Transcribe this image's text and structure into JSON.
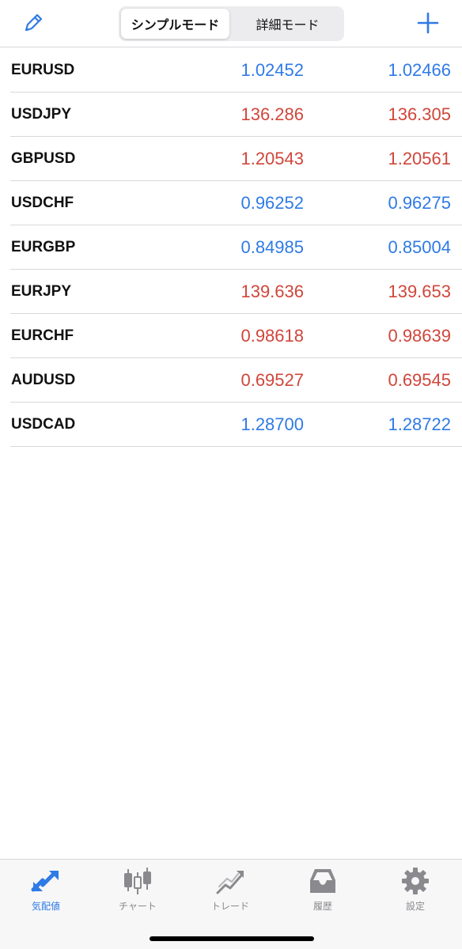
{
  "header": {
    "edit_icon": "pencil-icon",
    "add_icon": "plus-icon",
    "segments": [
      "シンプルモード",
      "詳細モード"
    ],
    "active_segment": "シンプルモード"
  },
  "colors": {
    "up": "#2f7ae5",
    "down": "#d0463b",
    "accent": "#2f7ae5"
  },
  "quotes": [
    {
      "symbol": "EURUSD",
      "bid": "1.02452",
      "ask": "1.02466",
      "direction": "up"
    },
    {
      "symbol": "USDJPY",
      "bid": "136.286",
      "ask": "136.305",
      "direction": "down"
    },
    {
      "symbol": "GBPUSD",
      "bid": "1.20543",
      "ask": "1.20561",
      "direction": "down"
    },
    {
      "symbol": "USDCHF",
      "bid": "0.96252",
      "ask": "0.96275",
      "direction": "up"
    },
    {
      "symbol": "EURGBP",
      "bid": "0.84985",
      "ask": "0.85004",
      "direction": "up"
    },
    {
      "symbol": "EURJPY",
      "bid": "139.636",
      "ask": "139.653",
      "direction": "down"
    },
    {
      "symbol": "EURCHF",
      "bid": "0.98618",
      "ask": "0.98639",
      "direction": "down"
    },
    {
      "symbol": "AUDUSD",
      "bid": "0.69527",
      "ask": "0.69545",
      "direction": "down"
    },
    {
      "symbol": "USDCAD",
      "bid": "1.28700",
      "ask": "1.28722",
      "direction": "up"
    }
  ],
  "tabbar": {
    "items": [
      {
        "label": "気配値",
        "icon": "quotes-arrows-icon",
        "active": true
      },
      {
        "label": "チャート",
        "icon": "candlestick-chart-icon",
        "active": false
      },
      {
        "label": "トレード",
        "icon": "trade-arrow-icon",
        "active": false
      },
      {
        "label": "履歴",
        "icon": "inbox-history-icon",
        "active": false
      },
      {
        "label": "設定",
        "icon": "gear-icon",
        "active": false
      }
    ]
  }
}
